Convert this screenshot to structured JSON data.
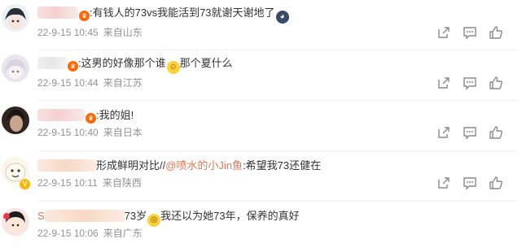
{
  "comments": [
    {
      "name_display": "",
      "text": ":有钱人的73vs我能活到73就谢天谢地了",
      "emoji": "😳",
      "time": "22-9-15 10:45",
      "location": "来自山东",
      "avatar_color": "#f2f2f2"
    },
    {
      "name_display": "",
      "text": ":这男的好像那个谁",
      "emoji": "😂",
      "text_after": "那个夏什么",
      "time": "22-9-15 10:44",
      "location": "来自江苏",
      "avatar_color": "#ece6ef"
    },
    {
      "name_display": "",
      "text": ":我的姐!",
      "time": "22-9-15 10:40",
      "location": "来自日本",
      "avatar_color": "#3b2f2a"
    },
    {
      "name_display": "",
      "text_prefix": "形成鲜明对比//",
      "mention": "@喷水的小Jin鱼",
      "text": ":希望我73还健在",
      "time": "22-9-15 10:11",
      "location": "来自陕西",
      "avatar_color": "#f7f1e6"
    },
    {
      "name_display": "S",
      "text": "73岁",
      "emoji": "😲",
      "text_after": "我还以为她73年，保养的真好",
      "time": "22-9-15 10:06",
      "location": "来自广东",
      "avatar_color": "#f6d9d9"
    }
  ],
  "icons": {
    "share": "share-icon",
    "comment": "comment-icon",
    "like": "like-icon"
  },
  "colors": {
    "meta": "#939393",
    "mention": "#eb7350",
    "badge": "#ff6a00"
  }
}
